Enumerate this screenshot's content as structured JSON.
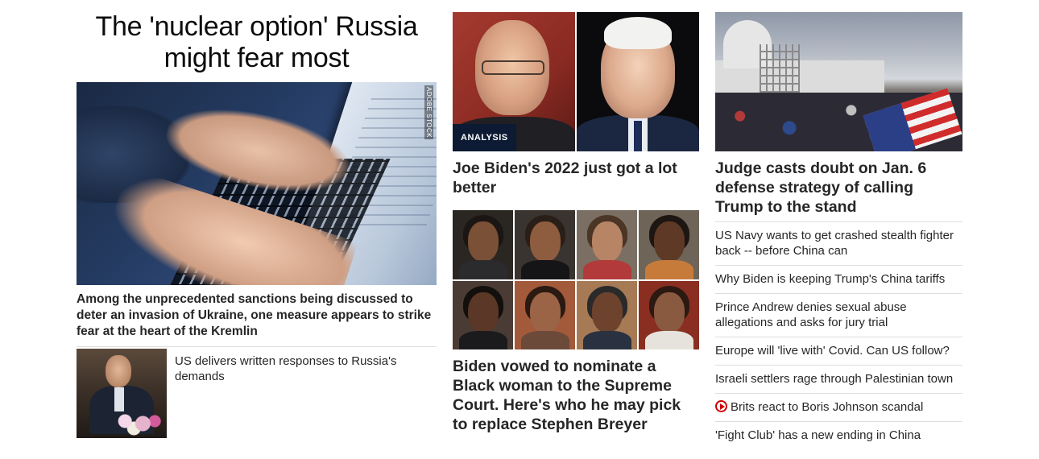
{
  "col1": {
    "headline": "The 'nuclear option' Russia might fear most",
    "hero_credit": "ADOBE STOCK",
    "hero_caption": "Among the unprecedented sanctions being discussed to deter an invasion of Ukraine, one measure appears to strike fear at the heart of the Kremlin",
    "small_story": "US delivers written responses to Russia's demands"
  },
  "col2": {
    "analysis_badge": "ANALYSIS",
    "story1_title": "Joe Biden's 2022 just got a lot better",
    "story2_title": "Biden vowed to nominate a Black woman to the Supreme Court. Here's who he may pick to replace Stephen Breyer"
  },
  "col3": {
    "story_title": "Judge casts doubt on Jan. 6 defense strategy of calling Trump to the stand",
    "list": [
      "US Navy wants to get crashed stealth fighter back -- before China can",
      "Why Biden is keeping Trump's China tariffs",
      "Prince Andrew denies sexual abuse allegations and asks for jury trial",
      "Europe will 'live with' Covid. Can US follow?",
      "Israeli settlers rage through Palestinian town",
      "Brits react to Boris Johnson scandal",
      "'Fight Club' has a new ending in China"
    ],
    "video_icon": "play-circle-icon"
  },
  "colors": {
    "text": "#262626",
    "divider": "#dedede",
    "analysis_bg": "#0c1b33",
    "video_red": "#cc0000"
  }
}
